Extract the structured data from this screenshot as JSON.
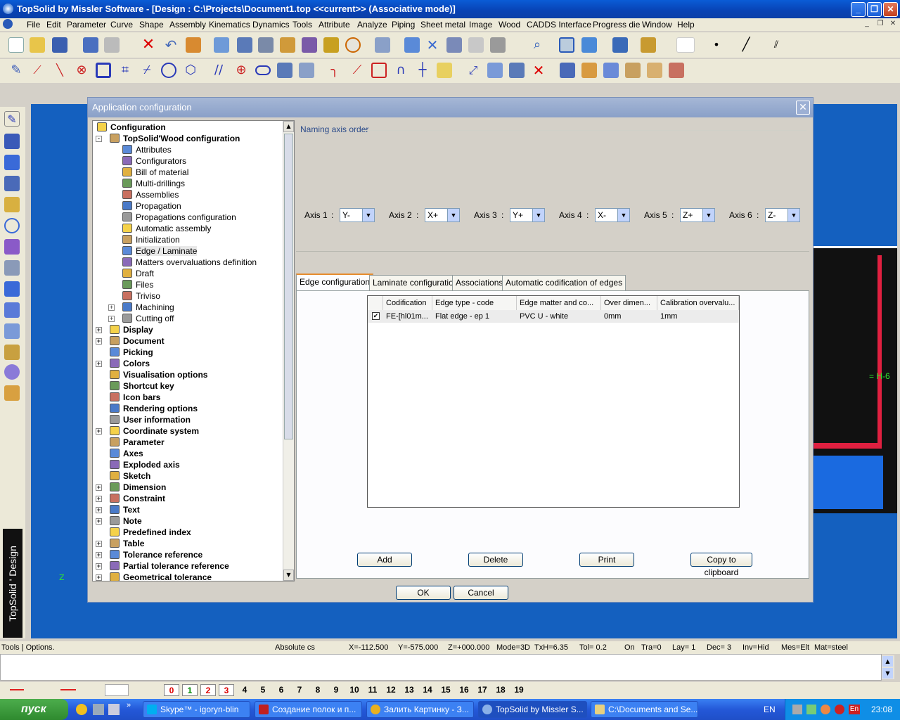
{
  "window": {
    "title": "TopSolid by Missler Software - [Design : C:\\Projects\\Document1.top  <<current>> (Associative mode)]"
  },
  "menu": [
    "File",
    "Edit",
    "Parameter",
    "Curve",
    "Shape",
    "Assembly",
    "Kinematics",
    "Dynamics",
    "Tools",
    "Attribute",
    "Analyze",
    "Piping",
    "Sheet metal",
    "Image",
    "Wood",
    "CADDS Interface",
    "Progress die",
    "Window",
    "Help"
  ],
  "brand": "TopSolid ' Design",
  "viewport": {
    "label": "= H-6",
    "axis": "Z"
  },
  "dialog": {
    "title": "Application configuration",
    "tree": [
      {
        "label": "Configuration",
        "bold": true,
        "level": 0,
        "icon": "folder-icon"
      },
      {
        "label": "TopSolid'Wood configuration",
        "bold": true,
        "level": 1,
        "exp": "-",
        "icon": "wood-icon"
      },
      {
        "label": "Attributes",
        "level": 2,
        "icon": "attributes-icon"
      },
      {
        "label": "Configurators",
        "level": 2,
        "icon": "configurators-icon"
      },
      {
        "label": "Bill of material",
        "level": 2,
        "icon": "bill-icon"
      },
      {
        "label": "Multi-drillings",
        "level": 2,
        "icon": "drill-icon"
      },
      {
        "label": "Assemblies",
        "level": 2,
        "icon": "assembly-icon"
      },
      {
        "label": "Propagation",
        "level": 2,
        "icon": "propagation-icon"
      },
      {
        "label": "Propagations configuration",
        "level": 2,
        "icon": "propagation-config-icon"
      },
      {
        "label": "Automatic assembly",
        "level": 2,
        "icon": "auto-assembly-icon"
      },
      {
        "label": "Initialization",
        "level": 2,
        "icon": "init-icon"
      },
      {
        "label": "Edge / Laminate",
        "level": 2,
        "icon": "edge-icon",
        "selected": true
      },
      {
        "label": "Matters overvaluations definition",
        "level": 2,
        "icon": "matters-icon"
      },
      {
        "label": "Draft",
        "level": 2,
        "icon": "draft-icon"
      },
      {
        "label": "Files",
        "level": 2,
        "icon": "files-icon"
      },
      {
        "label": "Triviso",
        "level": 2,
        "icon": "triviso-icon"
      },
      {
        "label": "Machining",
        "level": 2,
        "exp": "+",
        "icon": "machining-icon"
      },
      {
        "label": "Cutting off",
        "level": 2,
        "exp": "+",
        "icon": "cutting-icon"
      },
      {
        "label": "Display",
        "bold": true,
        "level": 1,
        "exp": "+",
        "icon": "display-icon"
      },
      {
        "label": "Document",
        "bold": true,
        "level": 1,
        "exp": "+",
        "icon": "document-icon"
      },
      {
        "label": "Picking",
        "bold": true,
        "level": 1,
        "icon": "picking-icon"
      },
      {
        "label": "Colors",
        "bold": true,
        "level": 1,
        "exp": "+",
        "icon": "colors-icon"
      },
      {
        "label": "Visualisation options",
        "bold": true,
        "level": 1,
        "icon": "visual-icon"
      },
      {
        "label": "Shortcut key",
        "bold": true,
        "level": 1,
        "icon": "shortcut-icon"
      },
      {
        "label": "Icon bars",
        "bold": true,
        "level": 1,
        "icon": "iconbars-icon"
      },
      {
        "label": "Rendering options",
        "bold": true,
        "level": 1,
        "icon": "rendering-icon"
      },
      {
        "label": "User information",
        "bold": true,
        "level": 1,
        "icon": "user-icon"
      },
      {
        "label": "Coordinate system",
        "bold": true,
        "level": 1,
        "exp": "+",
        "icon": "coord-icon"
      },
      {
        "label": "Parameter",
        "bold": true,
        "level": 1,
        "icon": "parameter-icon"
      },
      {
        "label": "Axes",
        "bold": true,
        "level": 1,
        "icon": "axes-icon"
      },
      {
        "label": "Exploded axis",
        "bold": true,
        "level": 1,
        "icon": "exploded-icon"
      },
      {
        "label": "Sketch",
        "bold": true,
        "level": 1,
        "icon": "sketch-icon"
      },
      {
        "label": "Dimension",
        "bold": true,
        "level": 1,
        "exp": "+",
        "icon": "dimension-icon"
      },
      {
        "label": "Constraint",
        "bold": true,
        "level": 1,
        "exp": "+",
        "icon": "constraint-icon"
      },
      {
        "label": "Text",
        "bold": true,
        "level": 1,
        "exp": "+",
        "icon": "text-icon"
      },
      {
        "label": "Note",
        "bold": true,
        "level": 1,
        "exp": "+",
        "icon": "note-icon"
      },
      {
        "label": "Predefined index",
        "bold": true,
        "level": 1,
        "icon": "index-icon"
      },
      {
        "label": "Table",
        "bold": true,
        "level": 1,
        "exp": "+",
        "icon": "table-icon"
      },
      {
        "label": "Tolerance reference",
        "bold": true,
        "level": 1,
        "exp": "+",
        "icon": "tolerance-icon"
      },
      {
        "label": "Partial tolerance reference",
        "bold": true,
        "level": 1,
        "exp": "+",
        "icon": "partial-tolerance-icon"
      },
      {
        "label": "Geometrical tolerance",
        "bold": true,
        "level": 1,
        "exp": "+",
        "icon": "geo-tolerance-icon"
      }
    ],
    "naming_group": "Naming axis order",
    "axes": [
      {
        "label": "Axis 1",
        "value": "Y-"
      },
      {
        "label": "Axis 2",
        "value": "X+"
      },
      {
        "label": "Axis 3",
        "value": "Y+"
      },
      {
        "label": "Axis 4",
        "value": "X-"
      },
      {
        "label": "Axis 5",
        "value": "Z+"
      },
      {
        "label": "Axis 6",
        "value": "Z-"
      }
    ],
    "tabs": [
      "Edge configuration",
      "Laminate configuration",
      "Associations",
      "Automatic codification of edges"
    ],
    "grid": {
      "columns": [
        "Codification",
        "Edge type - code",
        "Edge matter and co...",
        "Over dimen...",
        "Calibration overvalu..."
      ],
      "rows": [
        [
          "FE-[hl01m...",
          "Flat edge - ep 1",
          "PVC U - white",
          "0mm",
          "1mm"
        ]
      ]
    },
    "buttons": {
      "add": "Add",
      "delete": "Delete",
      "print": "Print",
      "copy": "Copy to clipboard",
      "ok": "OK",
      "cancel": "Cancel"
    }
  },
  "status": {
    "left": "Tools | Options.",
    "cs": "Absolute cs",
    "x": "X=-112.500",
    "y": "Y=-575.000",
    "z": "Z=+000.000",
    "mode": "Mode=3D",
    "txh": "TxH=6.35",
    "tol": "Tol=  0.2",
    "on": "On",
    "tra": "Tra=0",
    "lay": "Lay= 1",
    "dec": "Dec= 3",
    "inv": "Inv=Hid",
    "mes": "Mes=Elt",
    "mat": "Mat=steel"
  },
  "layers": [
    "0",
    "1",
    "2",
    "3",
    "4",
    "5",
    "6",
    "7",
    "8",
    "9",
    "10",
    "11",
    "12",
    "13",
    "14",
    "15",
    "16",
    "17",
    "18",
    "19"
  ],
  "taskbar": {
    "start": "пуск",
    "tasks": [
      "Skype™ - igoryn-blin",
      "Создание полок и п...",
      "Залить Картинку - З...",
      "TopSolid by Missler S...",
      "C:\\Documents and Se..."
    ],
    "lang": "EN",
    "clock": "23:08"
  }
}
